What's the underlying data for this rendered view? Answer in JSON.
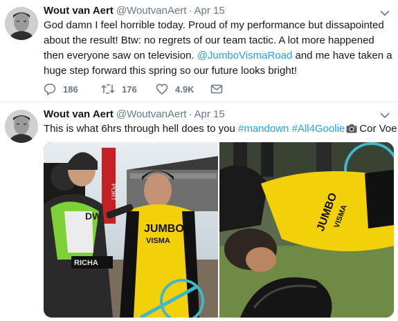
{
  "tweets": [
    {
      "author_name": "Wout van Aert",
      "handle": "@WoutvanAert",
      "separator": "·",
      "date": "Apr 15",
      "text_before_mention": "God damn I feel horrible today. Proud of my performance but dissapointed about the result! Btw: no regrets of our team tactic. A lot more happened then everyone saw on television. ",
      "mention": "@JumboVismaRoad",
      "text_after_mention": " and me have taken a huge step forward this spring  so our future looks bright!",
      "replies": "186",
      "retweets": "176",
      "likes": "4.9K"
    },
    {
      "author_name": "Wout van Aert",
      "handle": "@WoutvanAert",
      "separator": "·",
      "date": "Apr 15",
      "text_before": "This is what 6hrs through hell does to you ",
      "hashtag1": "#mandown",
      "hashtag2": "#All4Goolie",
      "camera_emoji_name": "camera-icon",
      "credit": "Cor Voe",
      "photo_left_text": {
        "jumbo": "JUMBO",
        "visma": "VISMA",
        "bib": "DW",
        "bag": "RICHA",
        "banner": "PORT"
      },
      "photo_right_text": {
        "jumbo": "JUMBO",
        "visma": "VISMA"
      }
    }
  ],
  "colors": {
    "link": "#1da1f2",
    "secondary": "#657786",
    "jumbo_yellow": "#f3d10a"
  }
}
